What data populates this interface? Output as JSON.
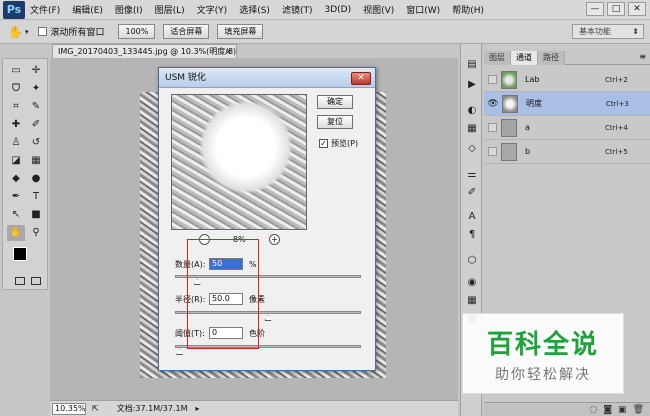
{
  "app": {
    "logo": "Ps",
    "colors": {
      "accent": "#3b6fd6",
      "watermark": "#1ea33a"
    }
  },
  "menu": [
    "文件(F)",
    "编辑(E)",
    "图像(I)",
    "图层(L)",
    "文字(Y)",
    "选择(S)",
    "滤镜(T)",
    "3D(D)",
    "视图(V)",
    "窗口(W)",
    "帮助(H)"
  ],
  "window_controls": {
    "minimize": "—",
    "restore": "□",
    "close": "✕"
  },
  "options": {
    "tool_icon": "hand-icon",
    "scroll_all_label": "滚动所有窗口",
    "zoom_100": "100%",
    "fit_screen": "适合屏幕",
    "fill_screen": "填充屏幕",
    "workspace": "基本功能"
  },
  "document": {
    "tab_title": "IMG_20170403_133445.jpg @ 10.3%(明度/8) *",
    "tab_close": "×",
    "zoom": "10.35%",
    "doc_info": "文档:37.1M/37.1M"
  },
  "tools": [
    "move-icon",
    "marquee-icon",
    "lasso-icon",
    "magic-wand-icon",
    "crop-icon",
    "eyedropper-icon",
    "healing-icon",
    "brush-icon",
    "stamp-icon",
    "history-brush-icon",
    "eraser-icon",
    "gradient-icon",
    "blur-icon",
    "dodge-icon",
    "pen-icon",
    "type-icon",
    "path-select-icon",
    "shape-icon",
    "hand-icon",
    "zoom-icon"
  ],
  "tool_glyphs": [
    "▭",
    "✛",
    "ᗜ",
    "✦",
    "⌗",
    "✎",
    "✚",
    "✐",
    "♙",
    "↺",
    "◪",
    "▦",
    "◆",
    "●",
    "✒",
    "T",
    "↖",
    "■",
    "✋",
    "⚲"
  ],
  "channels_panel": {
    "tabs": [
      "图层",
      "通道",
      "路径"
    ],
    "active_tab": 1,
    "channels": [
      {
        "name": "Lab",
        "shortcut": "Ctrl+2",
        "visible": false,
        "selected": false
      },
      {
        "name": "明度",
        "shortcut": "Ctrl+3",
        "visible": true,
        "selected": true
      },
      {
        "name": "a",
        "shortcut": "Ctrl+4",
        "visible": false,
        "selected": false
      },
      {
        "name": "b",
        "shortcut": "Ctrl+5",
        "visible": false,
        "selected": false
      }
    ],
    "eye_glyph": "👁"
  },
  "usm_dialog": {
    "title": "USM 锐化",
    "close": "✕",
    "ok": "确定",
    "reset": "复位",
    "preview_label": "预览(P)",
    "preview_checked": true,
    "check_glyph": "✓",
    "zoom_percent": "8%",
    "zoom_out": "−",
    "zoom_in": "+",
    "amount": {
      "label": "数量(A):",
      "value": "50",
      "unit": "%",
      "slider_fraction": 0.1
    },
    "radius": {
      "label": "半径(R):",
      "value": "50.0",
      "unit": "像素",
      "slider_fraction": 0.5
    },
    "threshold": {
      "label": "阈值(T):",
      "value": "0",
      "unit": "色阶",
      "slider_fraction": 0.0
    }
  },
  "watermark": {
    "main": "百科全说",
    "sub": "助你轻松解决"
  }
}
